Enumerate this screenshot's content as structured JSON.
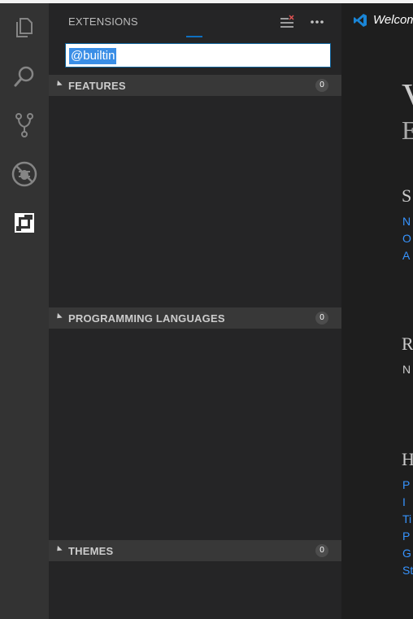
{
  "sidebar": {
    "title": "EXTENSIONS",
    "search": {
      "value": "@builtin"
    },
    "sections": [
      {
        "label": "FEATURES",
        "count": "0"
      },
      {
        "label": "PROGRAMMING LANGUAGES",
        "count": "0"
      },
      {
        "label": "THEMES",
        "count": "0"
      }
    ]
  },
  "activity_bar": {
    "items": [
      "explorer-icon",
      "search-icon",
      "source-control-icon",
      "debug-icon",
      "extensions-icon"
    ]
  },
  "editor": {
    "tab": {
      "label": "Welcome"
    },
    "welcome": {
      "title": "V",
      "subtitle": "E",
      "sections": [
        {
          "heading": "S",
          "links": [
            "N",
            "O",
            "A"
          ]
        },
        {
          "heading": "R",
          "text": "N"
        },
        {
          "heading": "H",
          "links": [
            "P",
            "I",
            "Ti",
            "P",
            "G",
            "St"
          ]
        }
      ]
    }
  },
  "colors": {
    "accent": "#0e70c0",
    "link": "#3794ff",
    "activity_bar": "#333333",
    "sidebar": "#252526",
    "section_header": "#383838"
  }
}
